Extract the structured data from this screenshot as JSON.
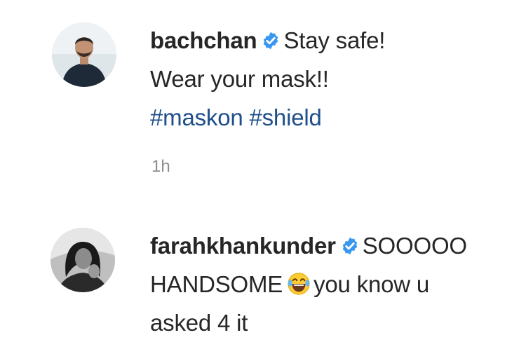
{
  "comments": [
    {
      "username": "bachchan",
      "verified": true,
      "text_1": "Stay safe!",
      "text_2": "Wear your mask!!",
      "hashtags": [
        "#maskon",
        "#shield"
      ],
      "timestamp": "1h",
      "avatar_icon": "avatar-photo"
    },
    {
      "username": "farahkhankunder",
      "verified": true,
      "text_1": "SOOOOO",
      "text_2": "HANDSOME",
      "emoji": "face-with-tears-of-joy",
      "text_3": "you know u",
      "text_4": "asked 4 it",
      "avatar_icon": "avatar-photo"
    }
  ],
  "colors": {
    "text": "#262626",
    "hashtag": "#1f4f8a",
    "verified": "#3897f0",
    "timestamp": "#8e8e8e"
  }
}
